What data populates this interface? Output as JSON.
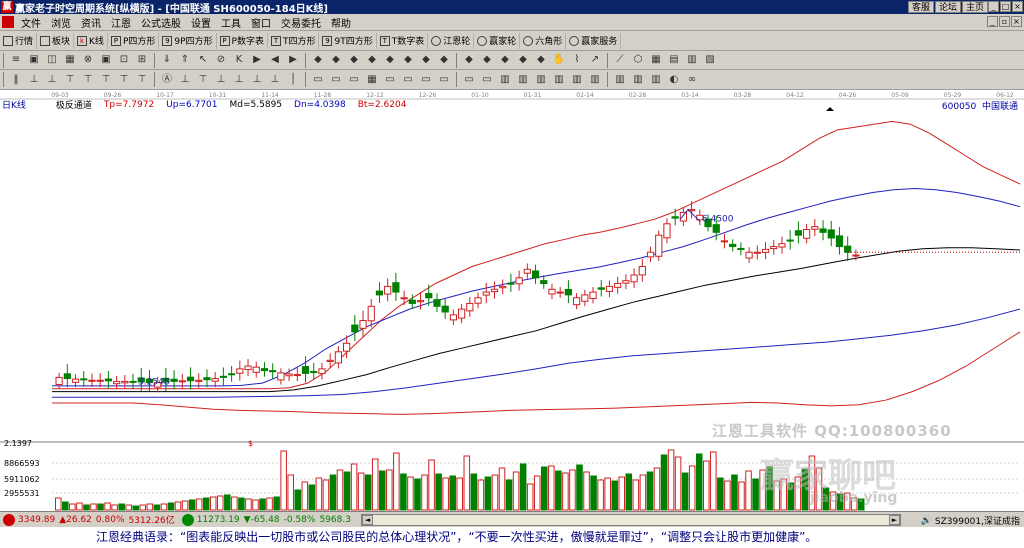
{
  "window": {
    "title": "赢家老子时空周期系统[纵横版] - [中国联通  SH600050-184日K线]",
    "links": [
      "客服",
      "论坛",
      "主页"
    ],
    "app_icon": "赢"
  },
  "menu": [
    "文件",
    "浏览",
    "资讯",
    "江恩",
    "公式选股",
    "设置",
    "工具",
    "窗口",
    "交易委托",
    "帮助"
  ],
  "toolbar1": [
    "行情",
    "板块",
    "K线",
    "P四方形",
    "9P四方形",
    "P数字表",
    "T四方形",
    "9T四方形",
    "T数字表",
    "江恩轮",
    "赢家轮",
    "六角形",
    "赢家服务"
  ],
  "chart_header": {
    "period": "日K线",
    "indicator": "极反通道",
    "tp": "Tp=7.7972",
    "up": "Up=6.7701",
    "md": "Md=5.5895",
    "dn": "Dn=4.0398",
    "bt": "Bt=2.6204",
    "code": "600050",
    "name": "中国联通"
  },
  "axis_dates": [
    "09-03",
    "09-26",
    "10-17",
    "10-31",
    "11-14",
    "11-28",
    "12-12",
    "12-26",
    "01-10",
    "01-31",
    "02-14",
    "02-28",
    "03-14",
    "03-28",
    "04-12",
    "04-26",
    "05-09",
    "05-29",
    "06-12"
  ],
  "price_labels": {
    "high": "6.4500",
    "low": "3.2548"
  },
  "volume_labels": [
    "2.1397",
    "8866593",
    "5911062",
    "2955531"
  ],
  "watermark": {
    "line1": "江恩工具软件   QQ:100800360",
    "line2": "赢家聊吧",
    "line3": "jiaoba.ying"
  },
  "status": {
    "sh_index": "3349.89",
    "sh_change": "▲26.62",
    "sh_pct": "0.80%",
    "sh_amount": "5312.26亿",
    "sz_index": "11273.19",
    "sz_change": "▼-65.48",
    "sz_pct": "-0.58%",
    "sz_amount": "5968.3",
    "right_text": "SZ399001,深证成指"
  },
  "quote": "江恩经典语录：“图表能反映出一切股市或公司股民的总体心理状况”，“不要一次性买进，傲慢就是罪过”，“调整只会让股市更加健康”。",
  "chart_data": {
    "type": "candlestick",
    "title": "中国联通 SH600050 日K线",
    "xlabel": "",
    "ylabel": "",
    "x_ticks": [
      "09-03",
      "09-26",
      "10-17",
      "10-31",
      "11-14",
      "11-28",
      "12-12",
      "12-26",
      "01-10",
      "01-31",
      "02-14",
      "02-28",
      "03-14",
      "03-28",
      "04-12",
      "04-26",
      "05-09",
      "05-29",
      "06-12"
    ],
    "ylim": [
      2.6204,
      7.7972
    ],
    "indicator": {
      "name": "极反通道",
      "Tp": 7.7972,
      "Up": 6.7701,
      "Md": 5.5895,
      "Dn": 4.0398,
      "Bt": 2.6204
    },
    "price_series": [
      {
        "name": "close",
        "values": [
          3.3,
          3.28,
          3.27,
          3.26,
          3.25,
          3.25,
          3.24,
          3.23,
          3.23,
          3.22,
          3.22,
          3.21,
          3.21,
          3.22,
          3.23,
          3.24,
          3.24,
          3.25,
          3.26,
          3.28,
          3.3,
          3.35,
          3.45,
          3.5,
          3.48,
          3.42,
          3.4,
          3.38,
          3.36,
          3.35,
          3.37,
          3.4,
          3.45,
          3.6,
          3.75,
          3.9,
          4.1,
          4.3,
          4.55,
          4.75,
          4.9,
          4.8,
          4.7,
          4.6,
          4.65,
          4.7,
          4.55,
          4.45,
          4.4,
          4.5,
          4.6,
          4.7,
          4.8,
          4.85,
          4.9,
          4.95,
          5.05,
          5.2,
          5.05,
          4.95,
          4.85,
          4.8,
          4.75,
          4.7,
          4.75,
          4.8,
          4.85,
          4.9,
          4.95,
          5.0,
          5.1,
          5.25,
          5.5,
          5.8,
          6.0,
          6.1,
          6.2,
          6.25,
          6.15,
          5.95,
          5.85,
          5.7,
          5.6,
          5.55,
          5.5,
          5.5,
          5.55,
          5.6,
          5.65,
          5.7,
          5.8,
          5.9,
          5.95,
          5.85,
          5.75,
          5.6,
          5.5,
          5.45
        ]
      },
      {
        "name": "upper_red",
        "values": [
          3.1,
          3.1,
          3.1,
          3.1,
          3.1,
          3.1,
          3.1,
          3.1,
          3.1,
          3.1,
          3.1,
          3.1,
          3.1,
          3.12,
          3.2,
          3.4,
          3.7,
          4.0,
          4.3,
          4.55,
          4.75,
          4.95,
          5.1,
          5.25,
          5.35,
          5.45,
          5.55,
          5.65,
          5.72,
          5.8,
          5.85,
          5.92,
          6.0,
          6.08,
          6.2,
          6.35,
          6.5,
          6.65,
          6.8,
          6.95,
          7.1,
          7.3,
          7.5,
          7.65,
          7.7,
          7.75,
          7.8,
          7.75,
          7.6,
          7.4,
          7.2,
          7.0,
          6.85,
          6.7
        ]
      },
      {
        "name": "mid_blue",
        "values": [
          3.15,
          3.15,
          3.15,
          3.15,
          3.15,
          3.15,
          3.15,
          3.15,
          3.15,
          3.16,
          3.2,
          3.35,
          3.55,
          3.8,
          4.0,
          4.2,
          4.35,
          4.5,
          4.62,
          4.72,
          4.82,
          4.9,
          4.98,
          5.05,
          5.12,
          5.18,
          5.24,
          5.32,
          5.4,
          5.5,
          5.6,
          5.72,
          5.85,
          5.98,
          6.1,
          6.2,
          6.3,
          6.4,
          6.48,
          6.55,
          6.6,
          6.62,
          6.6,
          6.55,
          6.48,
          6.4,
          6.3
        ]
      },
      {
        "name": "mid_black",
        "values": [
          3.05,
          3.05,
          3.05,
          3.05,
          3.05,
          3.05,
          3.05,
          3.05,
          3.05,
          3.05,
          3.08,
          3.15,
          3.25,
          3.35,
          3.48,
          3.6,
          3.72,
          3.82,
          3.92,
          4.02,
          4.12,
          4.25,
          4.38,
          4.5,
          4.62,
          4.72,
          4.82,
          4.92,
          5.0,
          5.08,
          5.15,
          5.22,
          5.3,
          5.38,
          5.45,
          5.52,
          5.56,
          5.58,
          5.58,
          5.56,
          5.54
        ]
      },
      {
        "name": "lower_blue",
        "values": [
          2.95,
          2.95,
          2.95,
          2.95,
          2.95,
          2.95,
          2.96,
          2.97,
          2.98,
          3.0,
          3.05,
          3.12,
          3.2,
          3.28,
          3.36,
          3.45,
          3.55,
          3.62,
          3.68,
          3.72,
          3.76,
          3.8,
          3.84,
          3.88,
          3.92,
          3.98,
          4.04,
          4.12,
          4.22,
          4.35,
          4.5
        ]
      },
      {
        "name": "lower_red",
        "values": [
          2.85,
          2.85,
          2.85,
          2.85,
          2.82,
          2.78,
          2.74,
          2.72,
          2.71,
          2.7,
          2.68,
          2.67,
          2.66,
          2.65,
          2.66,
          2.68,
          2.7,
          2.72,
          2.73,
          2.74,
          2.75,
          2.76,
          2.78,
          2.8,
          2.82,
          2.84,
          2.86,
          2.85,
          2.82,
          2.8,
          2.82,
          2.9,
          3.05,
          3.25,
          3.5,
          3.8,
          4.1
        ]
      }
    ],
    "volume": {
      "labels": [
        "2.1397",
        "8866593",
        "5911062",
        "2955531"
      ],
      "values": [
        1.2,
        0.8,
        0.6,
        0.7,
        0.5,
        0.6,
        0.6,
        0.7,
        0.5,
        0.6,
        0.5,
        0.4,
        0.5,
        0.6,
        0.5,
        0.6,
        0.7,
        0.8,
        0.9,
        1.0,
        1.1,
        1.2,
        1.3,
        1.4,
        1.5,
        1.3,
        1.2,
        1.1,
        1.0,
        1.1,
        1.2,
        1.3,
        5.9,
        3.5,
        2.0,
        2.8,
        2.5,
        3.2,
        3.0,
        3.5,
        4.0,
        3.8,
        4.6,
        3.7,
        3.5,
        5.1,
        3.9,
        4.0,
        5.7,
        3.6,
        3.3,
        3.1,
        3.5,
        5.0,
        3.6,
        3.2,
        3.4,
        3.2,
        5.4,
        3.6,
        3.0,
        3.3,
        3.5,
        4.2,
        3.0,
        3.8,
        4.6,
        2.6,
        3.4,
        4.3,
        4.4,
        3.9,
        3.7,
        4.0,
        4.5,
        3.8,
        3.4,
        3.0,
        3.2,
        2.9,
        3.3,
        3.6,
        3.0,
        3.5,
        3.8,
        4.2,
        5.5,
        6.0,
        5.3,
        3.7,
        4.4,
        5.6,
        4.9,
        5.8,
        3.2,
        2.9,
        3.5,
        2.8,
        3.9,
        3.1,
        4.0,
        4.3,
        2.9,
        3.1,
        2.7,
        3.3,
        4.1,
        5.4,
        4.2,
        2.2,
        1.8,
        1.6,
        1.7,
        1.2,
        1.1
      ]
    }
  }
}
